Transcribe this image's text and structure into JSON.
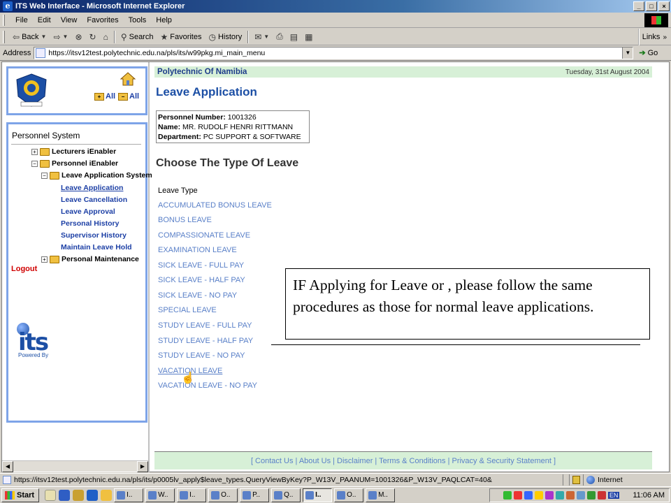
{
  "window": {
    "title": "ITS Web Interface - Microsoft Internet Explorer",
    "buttons": [
      "_",
      "□",
      "×"
    ]
  },
  "menubar": [
    "File",
    "Edit",
    "View",
    "Favorites",
    "Tools",
    "Help"
  ],
  "toolbar": {
    "back": "Back",
    "search": "Search",
    "favorites": "Favorites",
    "history": "History",
    "links": "Links"
  },
  "address": {
    "label": "Address",
    "url": "https://itsv12test.polytechnic.edu.na/pls/its/w99pkg.mi_main_menu",
    "go": "Go"
  },
  "sidebar": {
    "all_expand": "All",
    "all_collapse": "All",
    "menu_title": "Personnel System",
    "tree": [
      {
        "label": "Lecturers iEnabler",
        "exp": "+"
      },
      {
        "label": "Personnel iEnabler",
        "exp": "−"
      },
      {
        "label": "Leave Application System",
        "exp": "−"
      }
    ],
    "links": [
      "Leave Application",
      "Leave Cancellation",
      "Leave Approval",
      "Personal History",
      "Supervisor History",
      "Maintain Leave Hold"
    ],
    "personal_maintenance": "Personal Maintenance",
    "logout": "Logout",
    "powered_by": "Powered By",
    "its_logo": "its"
  },
  "content": {
    "org": "Polytechnic Of Namibia",
    "date": "Tuesday, 31st August 2004",
    "page_title": "Leave Application",
    "personnel": {
      "number_label": "Personnel Number:",
      "number_value": "1001326",
      "name_label": "Name:",
      "name_value": "MR. RUDOLF HENRI RITTMANN",
      "dept_label": "Department:",
      "dept_value": "PC SUPPORT & SOFTWARE"
    },
    "section_title": "Choose The Type Of Leave",
    "leave_type_header": "Leave Type",
    "leave_types": [
      "ACCUMULATED BONUS LEAVE",
      "BONUS LEAVE",
      "COMPASSIONATE LEAVE",
      "EXAMINATION LEAVE",
      "SICK LEAVE - FULL PAY",
      "SICK LEAVE - HALF PAY",
      "SICK LEAVE - NO PAY",
      "SPECIAL LEAVE",
      "STUDY LEAVE - FULL PAY",
      "STUDY LEAVE - HALF PAY",
      "STUDY LEAVE - NO PAY",
      "VACATION LEAVE",
      "VACATION LEAVE - NO PAY"
    ],
    "footer": "[ Contact Us | About Us | Disclaimer | Terms & Conditions | Privacy & Security Statement ]"
  },
  "callout": "IF Applying for Leave or , please follow the same procedures as those for normal leave applications.",
  "statusbar": {
    "url": "https://itsv12test.polytechnic.edu.na/pls/its/p0005lv_apply$leave_types.QueryViewByKey?P_W13V_PAANUM=1001326&P_W13V_PAQLCAT=40&",
    "zone": "Internet"
  },
  "taskbar": {
    "start": "Start",
    "tasks": [
      "I..",
      "W..",
      "I..",
      "O..",
      "P..",
      "Q..",
      "I..",
      "O..",
      "M.."
    ],
    "language": "EN",
    "clock": "11:06 AM"
  }
}
